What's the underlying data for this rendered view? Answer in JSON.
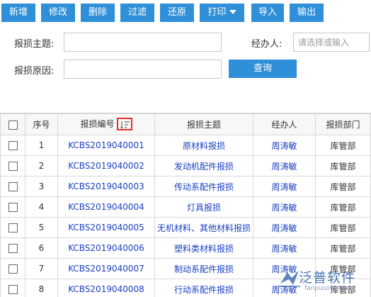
{
  "toolbar": {
    "add": "新增",
    "edit": "修改",
    "delete": "删除",
    "filter": "过滤",
    "restore": "还原",
    "print": "打印",
    "import": "导入",
    "export": "输出"
  },
  "filter": {
    "subject_label": "报损主题:",
    "subject_value": "",
    "handler_label": "经办人:",
    "handler_placeholder": "请选择或输入",
    "reason_label": "报损原因:",
    "reason_value": "",
    "query_label": "查询"
  },
  "grid": {
    "columns": [
      "序号",
      "报损编号",
      "报损主题",
      "经办人",
      "报损部门"
    ],
    "rows": [
      {
        "no": "1",
        "code": "KCBS2019040001",
        "subject": "原材料报损",
        "handler": "周涛敏",
        "dept": "库管部"
      },
      {
        "no": "2",
        "code": "KCBS2019040002",
        "subject": "发动机配件报损",
        "handler": "周涛敏",
        "dept": "库管部"
      },
      {
        "no": "3",
        "code": "KCBS2019040003",
        "subject": "传动系配件报损",
        "handler": "周涛敏",
        "dept": "库管部"
      },
      {
        "no": "4",
        "code": "KCBS2019040004",
        "subject": "灯具报损",
        "handler": "周涛敏",
        "dept": "库管部"
      },
      {
        "no": "5",
        "code": "KCBS2019040005",
        "subject": "无机材料、其他材料报损",
        "handler": "周涛敏",
        "dept": "库管部"
      },
      {
        "no": "6",
        "code": "KCBS2019040006",
        "subject": "塑料类材料报损",
        "handler": "周涛敏",
        "dept": "库管部"
      },
      {
        "no": "7",
        "code": "KCBS2019040007",
        "subject": "制动系配件报损",
        "handler": "周涛敏",
        "dept": "库管部"
      },
      {
        "no": "8",
        "code": "KCBS2019040008",
        "subject": "行动系配件报损",
        "handler": "周涛敏",
        "dept": "库管部"
      }
    ]
  },
  "watermark": {
    "name": "泛普软件",
    "url": "fanpusoft.com"
  },
  "colors": {
    "button": "#2f8fd8",
    "link": "#1a3fc0",
    "sort_highlight": "#e03030"
  }
}
